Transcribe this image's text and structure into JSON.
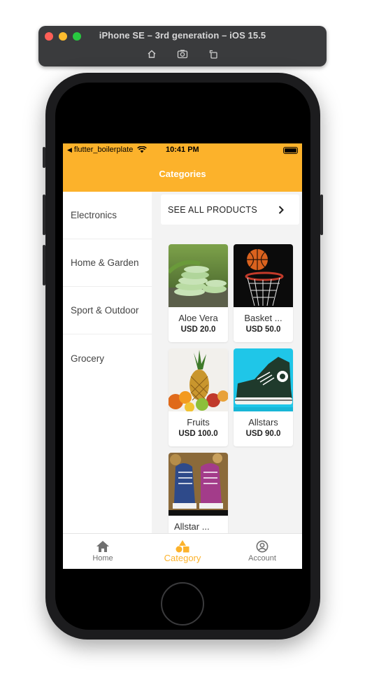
{
  "simulator": {
    "title": "iPhone SE – 3rd generation – iOS 15.5",
    "tools": [
      "home-icon",
      "screenshot-icon",
      "rotate-icon"
    ]
  },
  "status_bar": {
    "carrier": "flutter_boilerplate",
    "time": "10:41 PM"
  },
  "app_bar": {
    "title": "Categories",
    "color": "#fcb22b"
  },
  "categories": [
    {
      "label": "Electronics"
    },
    {
      "label": "Home & Garden"
    },
    {
      "label": "Sport & Outdoor"
    },
    {
      "label": "Grocery"
    }
  ],
  "see_all": {
    "label": "SEE ALL PRODUCTS",
    "icon": "chevron-right-icon"
  },
  "products": [
    {
      "name": "Aloe Vera",
      "price": "USD 20.0"
    },
    {
      "name": "Basket ...",
      "price": "USD 50.0"
    },
    {
      "name": "Fruits",
      "price": "USD 100.0"
    },
    {
      "name": "Allstars",
      "price": "USD 90.0"
    },
    {
      "name": "Allstar ...",
      "price": ""
    }
  ],
  "bottom_nav": {
    "items": [
      {
        "label": "Home",
        "icon": "home-icon"
      },
      {
        "label": "Category",
        "icon": "category-icon"
      },
      {
        "label": "Account",
        "icon": "account-icon"
      }
    ],
    "active": "Category"
  }
}
